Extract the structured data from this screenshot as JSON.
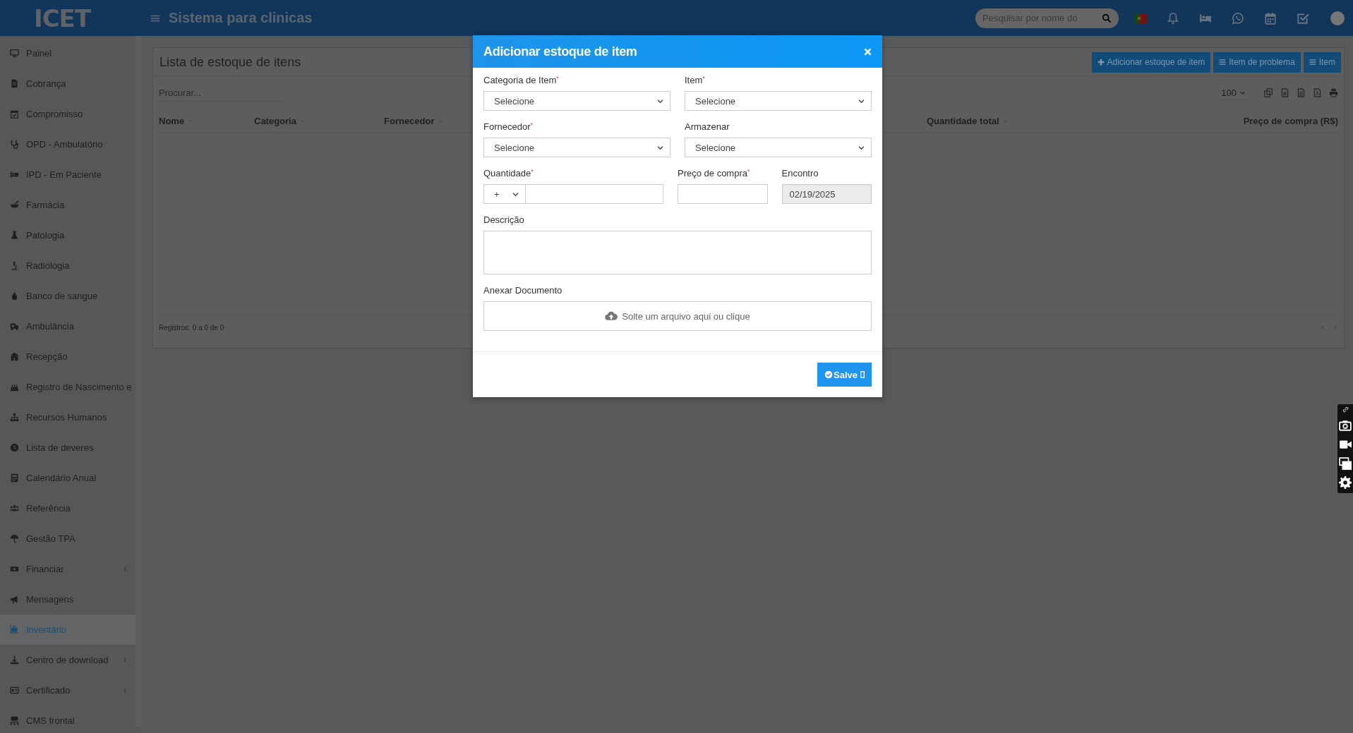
{
  "topbar": {
    "logo": "ICET",
    "title": "Sistema para clinicas",
    "search": {
      "placeholder": "Pesquisar por nome do"
    }
  },
  "sidebar": {
    "items": [
      {
        "label": "Painel",
        "selected": false,
        "expandable": false
      },
      {
        "label": "Cobrança",
        "selected": false,
        "expandable": false
      },
      {
        "label": "Compromisso",
        "selected": false,
        "expandable": false
      },
      {
        "label": "OPD - Ambulatório",
        "selected": false,
        "expandable": false
      },
      {
        "label": "IPD - Em Paciente",
        "selected": false,
        "expandable": false
      },
      {
        "label": "Farmácia",
        "selected": false,
        "expandable": false
      },
      {
        "label": "Patologia",
        "selected": false,
        "expandable": false
      },
      {
        "label": "Radiologia",
        "selected": false,
        "expandable": false
      },
      {
        "label": "Banco de sangue",
        "selected": false,
        "expandable": false
      },
      {
        "label": "Ambulância",
        "selected": false,
        "expandable": false
      },
      {
        "label": "Recepção",
        "selected": false,
        "expandable": false
      },
      {
        "label": "Registro de Nascimento e",
        "selected": false,
        "expandable": false
      },
      {
        "label": "Recursos Humanos",
        "selected": false,
        "expandable": false
      },
      {
        "label": "Lista de deveres",
        "selected": false,
        "expandable": false
      },
      {
        "label": "Calendário Anual",
        "selected": false,
        "expandable": false
      },
      {
        "label": "Referência",
        "selected": false,
        "expandable": false
      },
      {
        "label": "Gestão TPA",
        "selected": false,
        "expandable": false
      },
      {
        "label": "Financiar",
        "selected": false,
        "expandable": true
      },
      {
        "label": "Mensagens",
        "selected": false,
        "expandable": false
      },
      {
        "label": "Inventário",
        "selected": true,
        "expandable": false
      },
      {
        "label": "Centro de download",
        "selected": false,
        "expandable": true
      },
      {
        "label": "Certificado",
        "selected": false,
        "expandable": true
      },
      {
        "label": "CMS frontal",
        "selected": false,
        "expandable": false
      }
    ]
  },
  "list": {
    "title": "Lista de estoque de itens",
    "actions": [
      {
        "label": "Adicionar estoque de item",
        "kind": "add"
      },
      {
        "label": "Item de problema",
        "kind": "menu"
      },
      {
        "label": "Item",
        "kind": "menu"
      }
    ],
    "search": {
      "placeholder": "Procurar..."
    },
    "page_size": "100",
    "columns": [
      {
        "label": "Nome",
        "sortable": true
      },
      {
        "label": "Categoria",
        "sortable": true
      },
      {
        "label": "Fornecedor",
        "sortable": true
      },
      {
        "label": "Quantidade total",
        "sortable": true
      },
      {
        "label": "Preço de compra (R$)",
        "sortable": false
      }
    ],
    "footer": "Registros: 0 a 0 de 0"
  },
  "modal": {
    "title": "Adicionar estoque de item",
    "rows": [
      [
        {
          "label": "Categoria de Item",
          "required_mark": "*",
          "kind": "select",
          "value": "Selecione"
        },
        {
          "label": "Item",
          "required_mark": "*",
          "kind": "select",
          "value": "Selecione"
        }
      ],
      [
        {
          "label": "Fornecedor",
          "required_mark": "*",
          "kind": "select",
          "value": "Selecione"
        },
        {
          "label": "Armazenar",
          "kind": "select",
          "value": "Selecione"
        }
      ],
      [
        {
          "label": "Quantidade",
          "required_mark": "*",
          "kind": "signed",
          "sign": "+"
        },
        {
          "label": "Preço de compra",
          "required_mark": "*",
          "kind": "text"
        },
        {
          "label": "Encontro",
          "kind": "readonly",
          "value": "02/19/2025"
        }
      ],
      [
        {
          "label": "Descrição",
          "kind": "textarea"
        }
      ],
      [
        {
          "label": "Anexar Documento",
          "kind": "dropzone",
          "value": "Solte um arquivo aqui ou clique"
        }
      ]
    ],
    "save": "Salve"
  }
}
